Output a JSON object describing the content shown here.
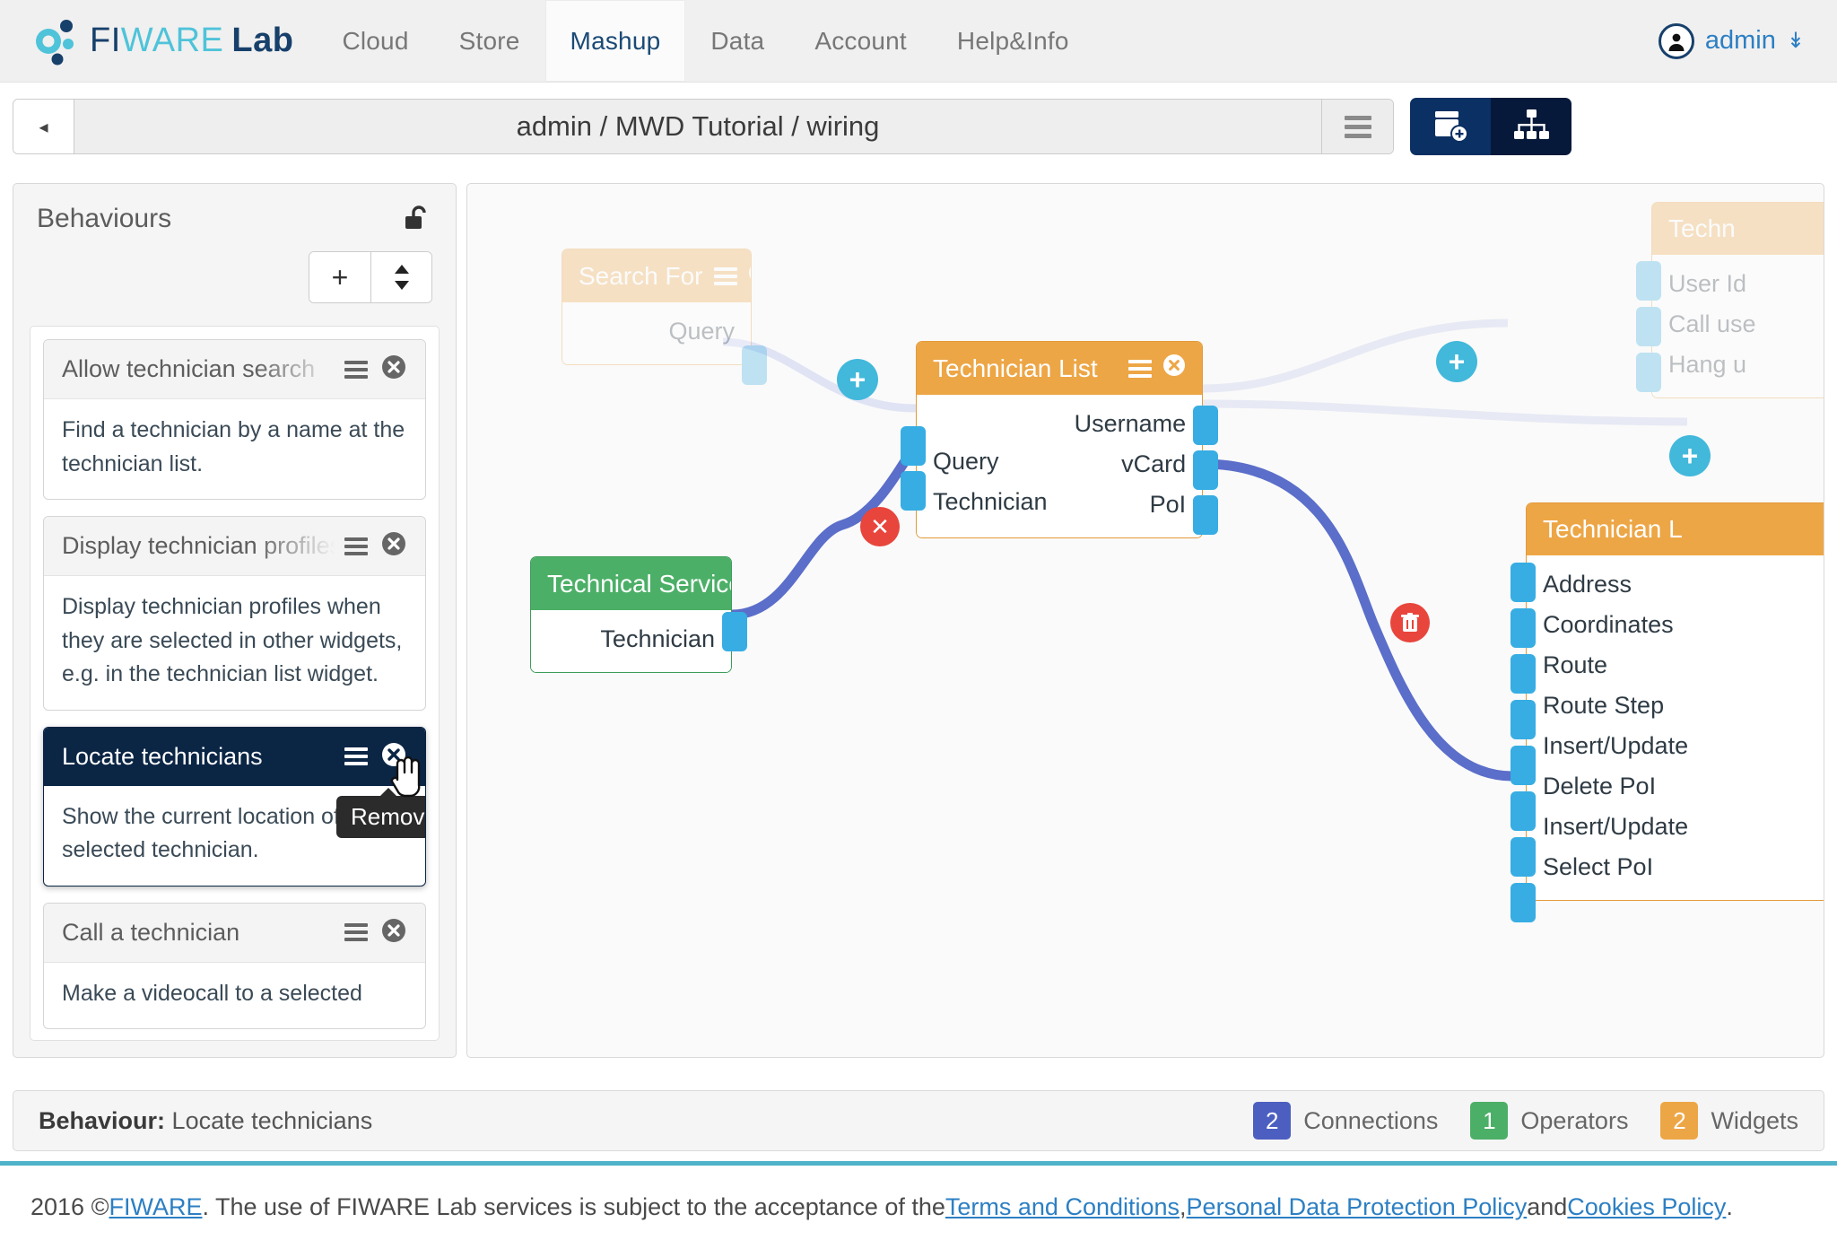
{
  "topnav": {
    "brand": {
      "fi": "FI",
      "wa": "WARE",
      "lab": "Lab"
    },
    "items": [
      {
        "label": "Cloud",
        "active": false
      },
      {
        "label": "Store",
        "active": false
      },
      {
        "label": "Mashup",
        "active": true
      },
      {
        "label": "Data",
        "active": false
      },
      {
        "label": "Account",
        "active": false
      },
      {
        "label": "Help&Info",
        "active": false
      }
    ],
    "user": {
      "name": "admin",
      "caret": "»"
    }
  },
  "toolbar": {
    "back_label": "◂",
    "title": "admin / MWD Tutorial / wiring",
    "menu_icon": "hamburger-icon",
    "button_new_icon": "add-component-icon",
    "button_wiring_icon": "wiring-tree-icon"
  },
  "sidebar": {
    "title": "Behaviours",
    "lock_icon": "unlocked-padlock-icon",
    "add_label": "+",
    "order_label": "↕",
    "behaviours": [
      {
        "title": "Allow technician search",
        "description": "Find a technician by a name at the technician list.",
        "selected": false
      },
      {
        "title": "Display technician profiles",
        "description": "Display technician profiles when they are selected in other widgets, e.g. in the technician list widget.",
        "selected": false
      },
      {
        "title": "Locate technicians",
        "description": "Show the current location of the selected technician.",
        "selected": true
      },
      {
        "title": "Call a technician",
        "description": "Make a videocall to a selected",
        "selected": false
      }
    ],
    "tooltip": "Remove"
  },
  "canvas": {
    "nodes": [
      {
        "name": "search-for-widget",
        "title": "Search For",
        "theme": "orange",
        "faded": true,
        "inputs": [],
        "outputs": [
          "Query"
        ],
        "head_icon": "add-circle-icon"
      },
      {
        "name": "technician-list-widget",
        "title": "Technician List",
        "theme": "orange",
        "faded": false,
        "inputs": [
          "Query",
          "Technician"
        ],
        "outputs": [
          "Username",
          "vCard",
          "PoI"
        ],
        "head_icon": "close-circle-icon"
      },
      {
        "name": "technical-service-operator",
        "title": "Technical Service",
        "theme": "green",
        "faded": false,
        "inputs": [],
        "outputs": [
          "Technician"
        ],
        "head_icon": "close-circle-icon"
      },
      {
        "name": "technician-locator-widget",
        "title": "Technician L",
        "theme": "orange",
        "faded": false,
        "inputs": [
          "Address",
          "Coordinates",
          "Route",
          "Route Step",
          "Insert/Update",
          "Delete PoI",
          "Insert/Update",
          "Select PoI"
        ],
        "outputs": [],
        "head_icon": "none"
      },
      {
        "name": "technician-call-widget",
        "title": "Techn",
        "theme": "orange",
        "faded": true,
        "inputs": [
          "User Id",
          "Call use",
          "Hang u"
        ],
        "outputs": [],
        "head_icon": "none"
      }
    ],
    "buttons": {
      "plus": "+",
      "close": "✕",
      "trash": "🗑"
    }
  },
  "statusbar": {
    "behaviour_label": "Behaviour:",
    "behaviour_name": "Locate technicians",
    "chips": [
      {
        "count": "2",
        "label": "Connections",
        "color": "#4c5fc1"
      },
      {
        "count": "1",
        "label": "Operators",
        "color": "#4caf67"
      },
      {
        "count": "2",
        "label": "Widgets",
        "color": "#eda646"
      }
    ]
  },
  "footer": {
    "prefix": "2016 © ",
    "link_fiware": "FIWARE",
    "mid": ". The use of FIWARE Lab services is subject to the acceptance of the ",
    "link_terms": "Terms and Conditions",
    "sep1": ", ",
    "link_privacy": "Personal Data Protection Policy",
    "sep2": " and ",
    "link_cookies": "Cookies Policy",
    "suffix": "."
  }
}
